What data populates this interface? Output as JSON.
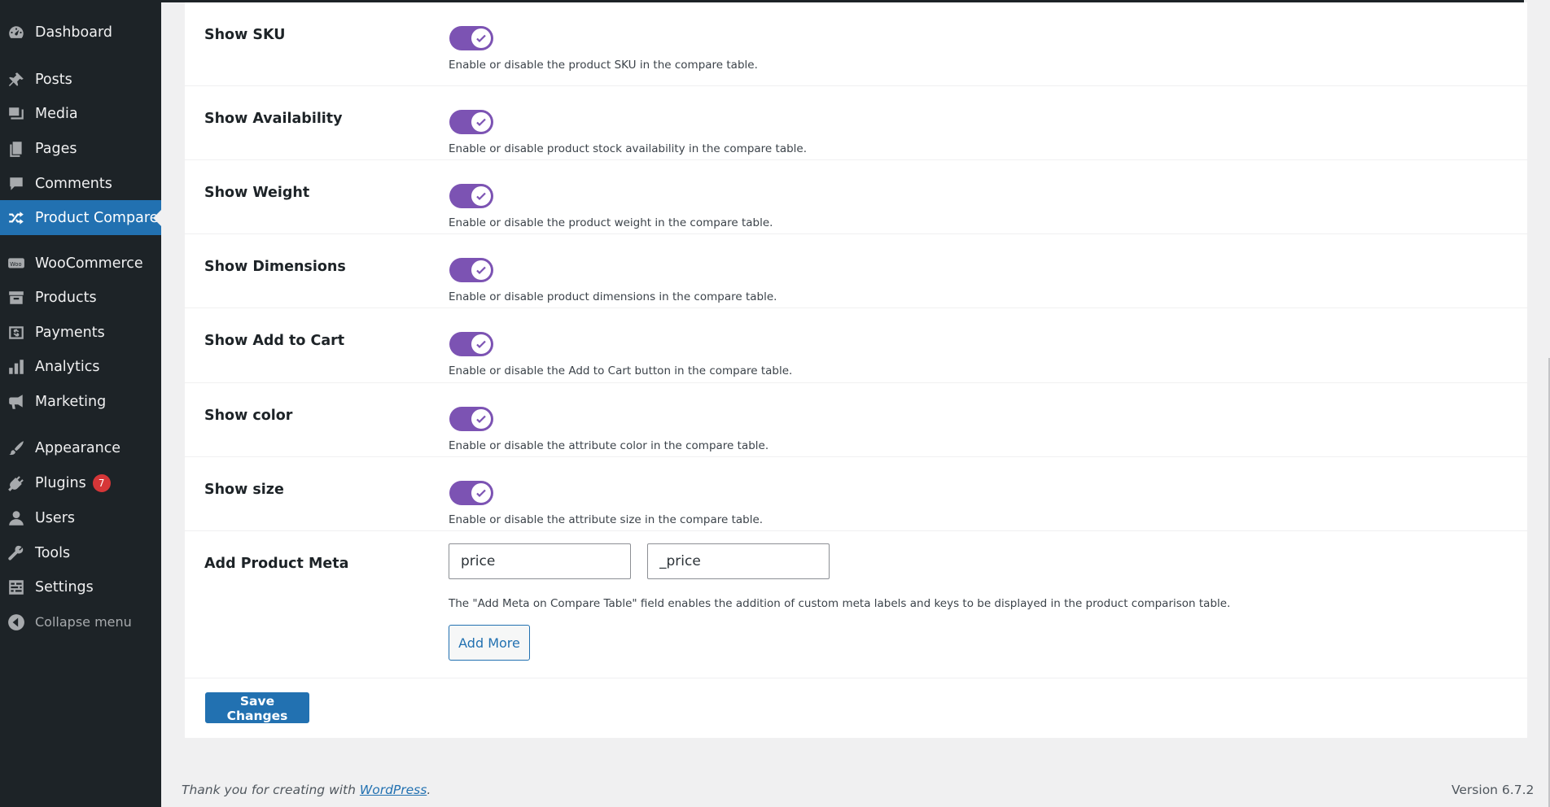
{
  "sidebar": {
    "items": [
      {
        "label": "Dashboard",
        "icon": "dashboard-icon",
        "current": false
      },
      {
        "label": "Posts",
        "icon": "pin-icon",
        "current": false
      },
      {
        "label": "Media",
        "icon": "media-icon",
        "current": false
      },
      {
        "label": "Pages",
        "icon": "pages-icon",
        "current": false
      },
      {
        "label": "Comments",
        "icon": "comment-icon",
        "current": false
      },
      {
        "label": "Product Compare",
        "icon": "shuffle-icon",
        "current": true
      },
      {
        "label": "WooCommerce",
        "icon": "woo-icon",
        "current": false
      },
      {
        "label": "Products",
        "icon": "archive-icon",
        "current": false
      },
      {
        "label": "Payments",
        "icon": "money-icon",
        "current": false
      },
      {
        "label": "Analytics",
        "icon": "bar-chart-icon",
        "current": false
      },
      {
        "label": "Marketing",
        "icon": "megaphone-icon",
        "current": false
      },
      {
        "label": "Appearance",
        "icon": "brush-icon",
        "current": false
      },
      {
        "label": "Plugins",
        "icon": "plug-icon",
        "current": false,
        "badge": "7"
      },
      {
        "label": "Users",
        "icon": "user-icon",
        "current": false
      },
      {
        "label": "Tools",
        "icon": "wrench-icon",
        "current": false
      },
      {
        "label": "Settings",
        "icon": "settings-icon",
        "current": false
      },
      {
        "label": "Collapse menu",
        "icon": "collapse-icon",
        "current": false
      }
    ]
  },
  "settings": {
    "rows": [
      {
        "label": "Show SKU",
        "enabled": true,
        "description": "Enable or disable the product SKU in the compare table."
      },
      {
        "label": "Show Availability",
        "enabled": true,
        "description": "Enable or disable product stock availability in the compare table."
      },
      {
        "label": "Show Weight",
        "enabled": true,
        "description": "Enable or disable the product weight in the compare table."
      },
      {
        "label": "Show Dimensions",
        "enabled": true,
        "description": "Enable or disable product dimensions in the compare table."
      },
      {
        "label": "Show Add to Cart",
        "enabled": true,
        "description": "Enable or disable the Add to Cart button in the compare table."
      },
      {
        "label": "Show color",
        "enabled": true,
        "description": "Enable or disable the attribute color in the compare table."
      },
      {
        "label": "Show size",
        "enabled": true,
        "description": "Enable or disable the attribute size in the compare table."
      }
    ],
    "meta": {
      "label": "Add Product Meta",
      "label_value": "price",
      "key_value": "_price",
      "description": "The \"Add Meta on Compare Table\" field enables the addition of custom meta labels and keys to be displayed in the product comparison table.",
      "add_more_label": "Add More"
    },
    "save_label": "Save Changes"
  },
  "footer": {
    "thanks_prefix": "Thank you for creating with ",
    "thanks_link": "WordPress",
    "thanks_suffix": ".",
    "version": "Version 6.7.2"
  },
  "colors": {
    "toggle_on": "#7c53b3",
    "sidebar_bg": "#1d2327",
    "accent": "#2271b1",
    "badge": "#d63638"
  }
}
